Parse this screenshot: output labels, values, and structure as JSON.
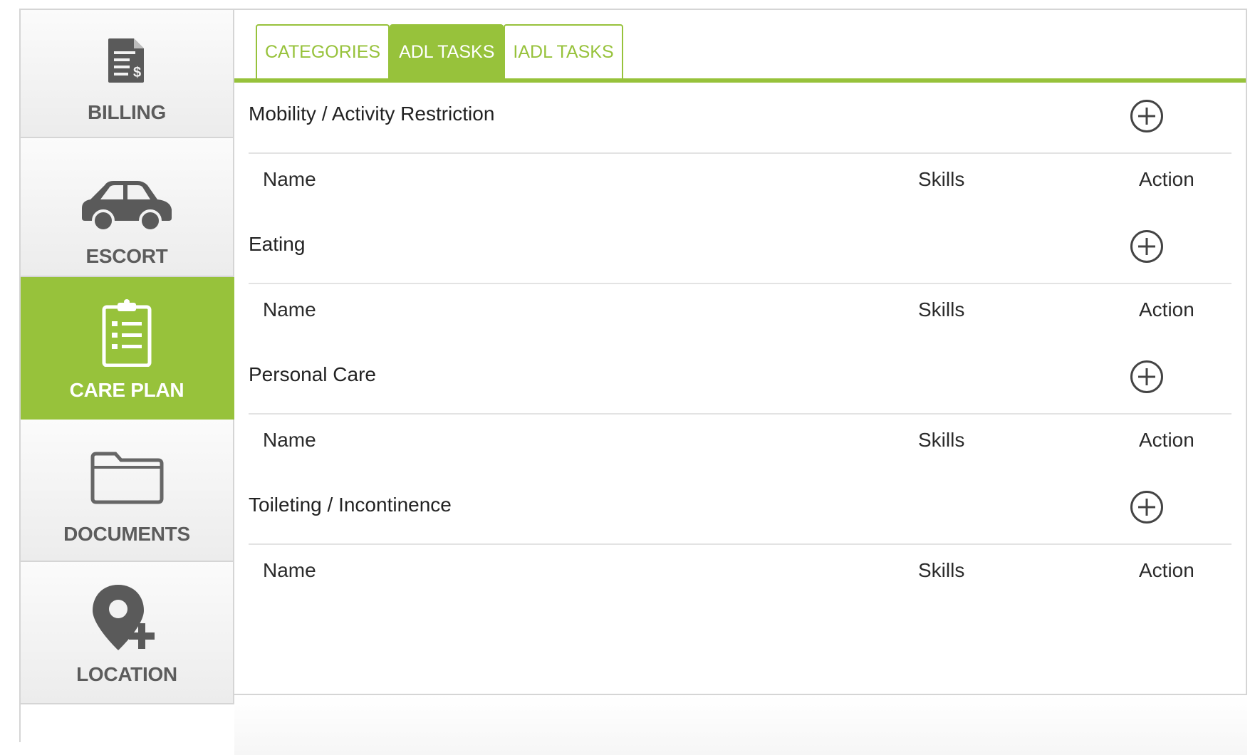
{
  "sidebar": {
    "items": [
      {
        "label": "BILLING",
        "icon": "billing-icon"
      },
      {
        "label": "ESCORT",
        "icon": "car-icon"
      },
      {
        "label": "CARE PLAN",
        "icon": "clipboard-icon",
        "active": true
      },
      {
        "label": "DOCUMENTS",
        "icon": "folder-icon"
      },
      {
        "label": "LOCATION",
        "icon": "add-location-icon"
      }
    ]
  },
  "tabs": [
    {
      "label": "CATEGORIES",
      "active": false
    },
    {
      "label": "ADL TASKS",
      "active": true
    },
    {
      "label": "IADL TASKS",
      "active": false
    }
  ],
  "sections": [
    {
      "title": "Mobility / Activity Restriction",
      "columns": {
        "name": "Name",
        "skills": "Skills",
        "action": "Action"
      }
    },
    {
      "title": "Eating",
      "columns": {
        "name": "Name",
        "skills": "Skills",
        "action": "Action"
      }
    },
    {
      "title": "Personal Care",
      "columns": {
        "name": "Name",
        "skills": "Skills",
        "action": "Action"
      }
    },
    {
      "title": "Toileting / Incontinence",
      "columns": {
        "name": "Name",
        "skills": "Skills",
        "action": "Action"
      }
    }
  ],
  "colors": {
    "accent": "#97c23b",
    "sidebar_text": "#5c5c5c",
    "icon_gray": "#555555"
  }
}
